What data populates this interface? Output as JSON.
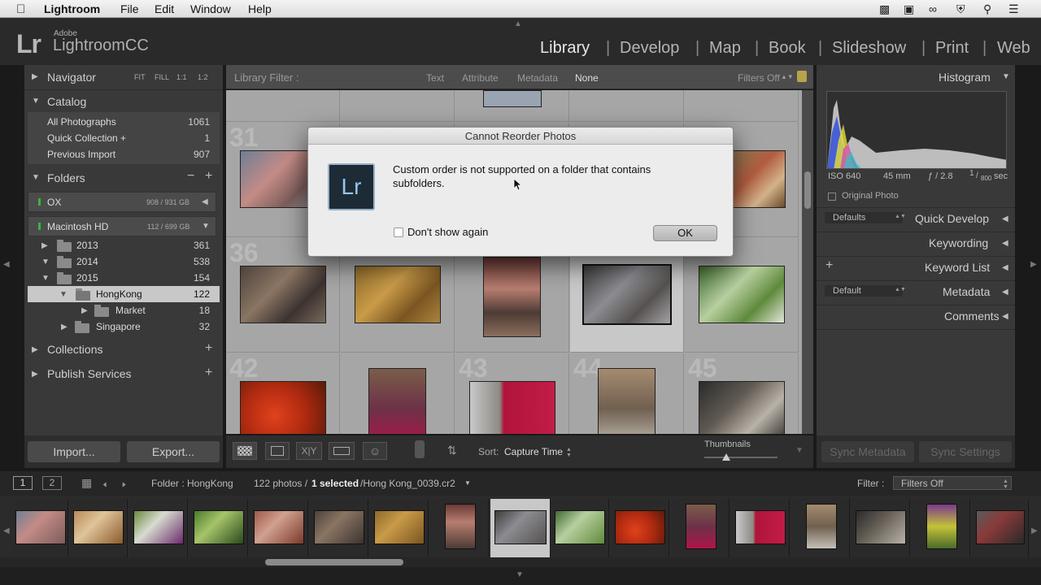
{
  "menubar": {
    "app": "Lightroom",
    "items": [
      "File",
      "Edit",
      "Window",
      "Help"
    ]
  },
  "brand": {
    "adobe": "Adobe",
    "product": "LightroomCC",
    "logo": "Lr"
  },
  "modules": [
    "Library",
    "Develop",
    "Map",
    "Book",
    "Slideshow",
    "Print",
    "Web"
  ],
  "left": {
    "navigator": {
      "label": "Navigator",
      "zoom": [
        "FIT",
        "FILL",
        "1:1",
        "1:2"
      ]
    },
    "catalog": {
      "label": "Catalog",
      "items": [
        {
          "label": "All Photographs",
          "count": "1061"
        },
        {
          "label": "Quick Collection +",
          "count": "1"
        },
        {
          "label": "Previous Import",
          "count": "907"
        }
      ]
    },
    "folders": {
      "label": "Folders",
      "volumes": [
        {
          "label": "OX",
          "size": "908 / 931 GB"
        },
        {
          "label": "Macintosh HD",
          "size": "112 / 699 GB"
        }
      ],
      "items": [
        {
          "label": "2013",
          "count": "361"
        },
        {
          "label": "2014",
          "count": "538"
        },
        {
          "label": "2015",
          "count": "154"
        },
        {
          "label": "HongKong",
          "count": "122"
        },
        {
          "label": "Market",
          "count": "18"
        },
        {
          "label": "Singapore",
          "count": "32"
        }
      ]
    },
    "collections": "Collections",
    "publish": "Publish Services",
    "import_label": "Import...",
    "export_label": "Export..."
  },
  "filterbar": {
    "label": "Library Filter :",
    "options": [
      "Text",
      "Attribute",
      "Metadata",
      "None"
    ],
    "preset": "Filters Off"
  },
  "grid": {
    "numbers": [
      "31",
      "36",
      "42",
      "43",
      "44",
      "45"
    ]
  },
  "dialog": {
    "title": "Cannot Reorder Photos",
    "message": "Custom order is not supported on a folder that contains subfolders.",
    "checkbox": "Don't show again",
    "ok": "OK",
    "icon": "Lr"
  },
  "right": {
    "histogram": {
      "label": "Histogram",
      "iso": "ISO 640",
      "focal": "45 mm",
      "aperture": "ƒ / 2.8",
      "shutter_num": "1",
      "shutter_den": "800",
      "shutter_unit": "sec",
      "original": "Original Photo"
    },
    "quick_develop": {
      "label": "Quick Develop",
      "preset": "Defaults"
    },
    "keywording": "Keywording",
    "keyword_list": "Keyword List",
    "metadata": {
      "label": "Metadata",
      "preset": "Default"
    },
    "comments": "Comments",
    "sync_metadata": "Sync Metadata",
    "sync_settings": "Sync Settings"
  },
  "toolbar": {
    "sort_label": "Sort:",
    "sort_value": "Capture Time",
    "thumbnails_label": "Thumbnails"
  },
  "filmstrip": {
    "screen1": "1",
    "screen2": "2",
    "folder": "Folder : HongKong",
    "count": "122 photos /",
    "selected": "1 selected",
    "file": "/Hong Kong_0039.cr2",
    "filter_label": "Filter :",
    "filter_value": "Filters Off"
  }
}
